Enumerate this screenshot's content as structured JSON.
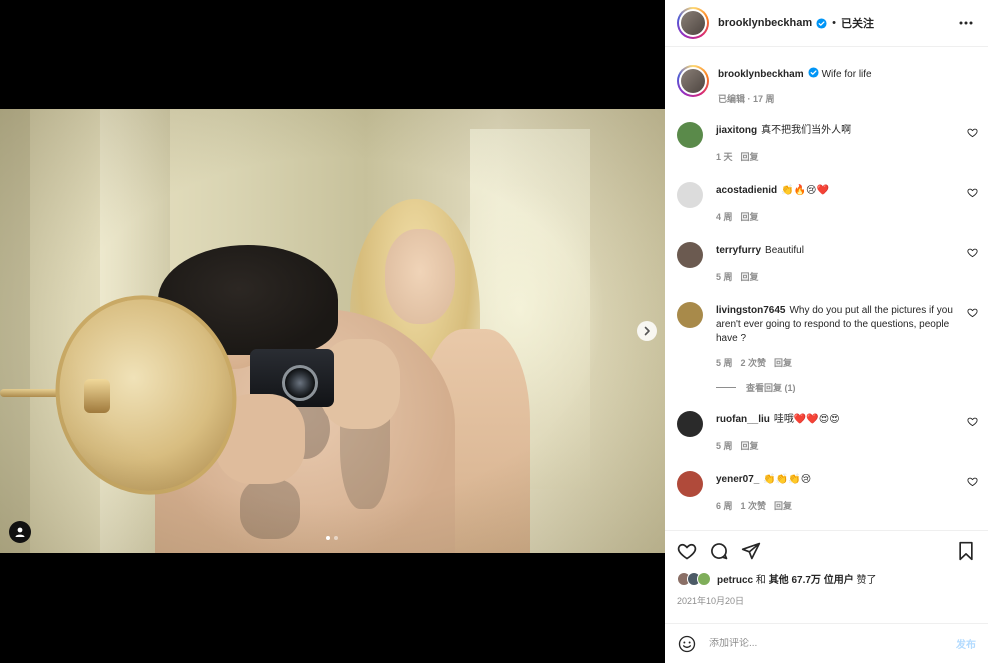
{
  "header": {
    "username": "brooklynbeckham",
    "separator": "•",
    "follow_status": "已关注"
  },
  "caption": {
    "username": "brooklynbeckham",
    "text": "Wife for life",
    "meta": "已编辑 · 17 周"
  },
  "comments": [
    {
      "username": "jiaxitong",
      "text": "真不把我们当外人啊",
      "time": "1 天",
      "likes": "",
      "reply": "回复",
      "avatar_color": "#5a8a4a"
    },
    {
      "username": "acostadienid",
      "text": "👏🔥😢❤️",
      "time": "4 周",
      "likes": "",
      "reply": "回复",
      "avatar_color": "#dcdcdc"
    },
    {
      "username": "terryfurry",
      "text": "Beautiful",
      "time": "5 周",
      "likes": "",
      "reply": "回复",
      "avatar_color": "#6b5a50"
    },
    {
      "username": "livingston7645",
      "text": "Why do you put all the pictures if you aren't ever going to respond to the questions, people have ?",
      "time": "5 周",
      "likes": "2 次赞",
      "reply": "回复",
      "avatar_color": "#a88a4a"
    },
    {
      "username": "ruofan__liu",
      "text": "哇哦❤️❤️😍😍",
      "time": "5 周",
      "likes": "",
      "reply": "回复",
      "avatar_color": "#2a2a2a"
    },
    {
      "username": "yener07_",
      "text": "👏👏👏😢",
      "time": "6 周",
      "likes": "1 次赞",
      "reply": "回复",
      "avatar_color": "#b04a3a"
    }
  ],
  "view_replies": "查看回复 (1)",
  "likes": {
    "liked_by": "petrucc",
    "connector": " 和 ",
    "others": "其他 67.7万 位用户",
    "suffix": " 赞了"
  },
  "date": "2021年10月20日",
  "comment_input": {
    "placeholder": "添加评论...",
    "post_label": "发布"
  },
  "colors": {
    "verified": "#0095f6",
    "post_button": "#b3dbff"
  },
  "icons": [
    "heart-icon",
    "comment-icon",
    "share-icon",
    "bookmark-icon",
    "emoji-icon",
    "more-icon",
    "chevron-right-icon",
    "user-tag-icon",
    "verified-badge-icon"
  ]
}
